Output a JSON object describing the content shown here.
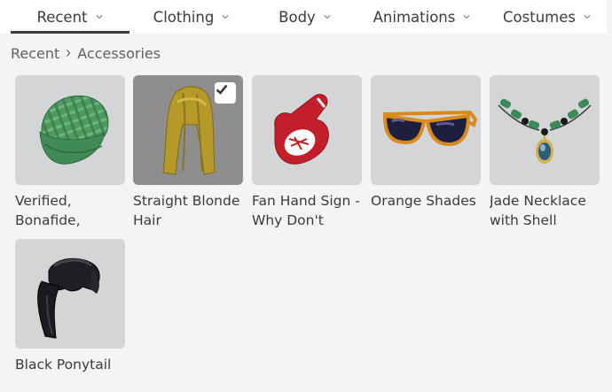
{
  "tabs": [
    {
      "label": "Recent",
      "active": true
    },
    {
      "label": "Clothing",
      "active": false
    },
    {
      "label": "Body",
      "active": false
    },
    {
      "label": "Animations",
      "active": false
    },
    {
      "label": "Costumes",
      "active": false
    }
  ],
  "breadcrumb": {
    "parent": "Recent",
    "current": "Accessories"
  },
  "items": [
    {
      "name": "Verified, Bonafide,",
      "icon": "green-plaid-cap-icon",
      "selected": false
    },
    {
      "name": "Straight Blonde Hair",
      "icon": "blonde-hair-icon",
      "selected": true
    },
    {
      "name": "Fan Hand Sign - Why Don't",
      "icon": "foam-finger-icon",
      "selected": false
    },
    {
      "name": "Orange Shades",
      "icon": "sunglasses-icon",
      "selected": false
    },
    {
      "name": "Jade Necklace with Shell",
      "icon": "necklace-icon",
      "selected": false
    },
    {
      "name": "Black Ponytail",
      "icon": "ponytail-icon",
      "selected": false
    }
  ],
  "colors": {
    "page_bg": "#f2f4f5",
    "thumb_bg": "#d3d5d7",
    "selected_thumb_bg": "#8e8e8e",
    "text": "#393b3d"
  }
}
